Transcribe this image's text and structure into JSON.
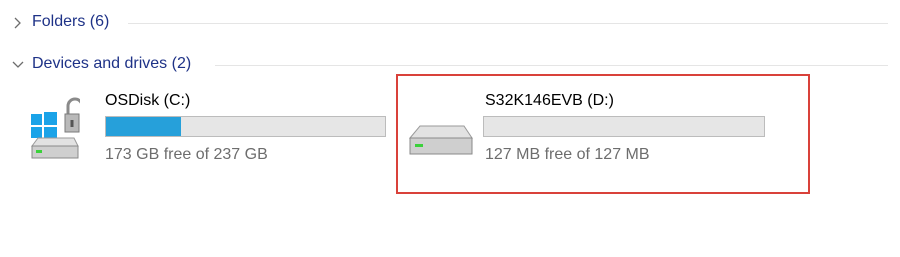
{
  "groups": [
    {
      "label": "Folders (6)",
      "expanded": false,
      "chevron_icon": "chevron-right-icon"
    },
    {
      "label": "Devices and drives (2)",
      "expanded": true,
      "chevron_icon": "chevron-down-icon"
    }
  ],
  "drives": [
    {
      "name": "OSDisk (C:)",
      "free_text": "173 GB free of 237 GB",
      "used_fraction": 0.27,
      "icon": "windows-system-drive-lock-icon",
      "bar_color": "#26a0da",
      "selected": false
    },
    {
      "name": "S32K146EVB (D:)",
      "free_text": "127 MB free of 127 MB",
      "used_fraction": 0.0,
      "icon": "hard-drive-icon",
      "bar_color": "#26a0da",
      "selected": true
    }
  ],
  "colors": {
    "group_label": "#1e3287",
    "selection_outline": "#d9413a",
    "bar_background": "#e6e6e6",
    "free_text": "#6d6d6d"
  }
}
